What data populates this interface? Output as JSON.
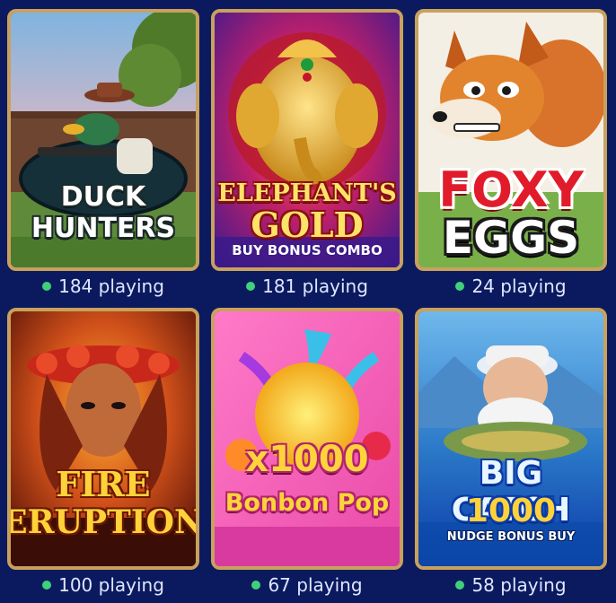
{
  "games": [
    {
      "title_lines": [
        "DUCK HUNTERS"
      ],
      "players": "184 playing"
    },
    {
      "title_lines": [
        "ELEPHANT'S",
        "GOLD",
        "BUY BONUS COMBO"
      ],
      "players": "181 playing"
    },
    {
      "title_lines": [
        "FOXY",
        "EGGS"
      ],
      "players": "24 playing"
    },
    {
      "title_lines": [
        "FIRE",
        "ERUPTION"
      ],
      "players": "100 playing"
    },
    {
      "title_lines": [
        "x1000",
        "Bonbon Pop"
      ],
      "players": "67 playing"
    },
    {
      "title_lines": [
        "BIG CATCH",
        "1000",
        "NUDGE BONUS BUY"
      ],
      "players": "58 playing"
    }
  ],
  "colors": {
    "background": "#0b1a5e",
    "card_border": "#c9a15c",
    "status_dot": "#3fd17a",
    "status_text": "#dfe6ff"
  },
  "icons": {
    "status": "online-dot-icon"
  }
}
